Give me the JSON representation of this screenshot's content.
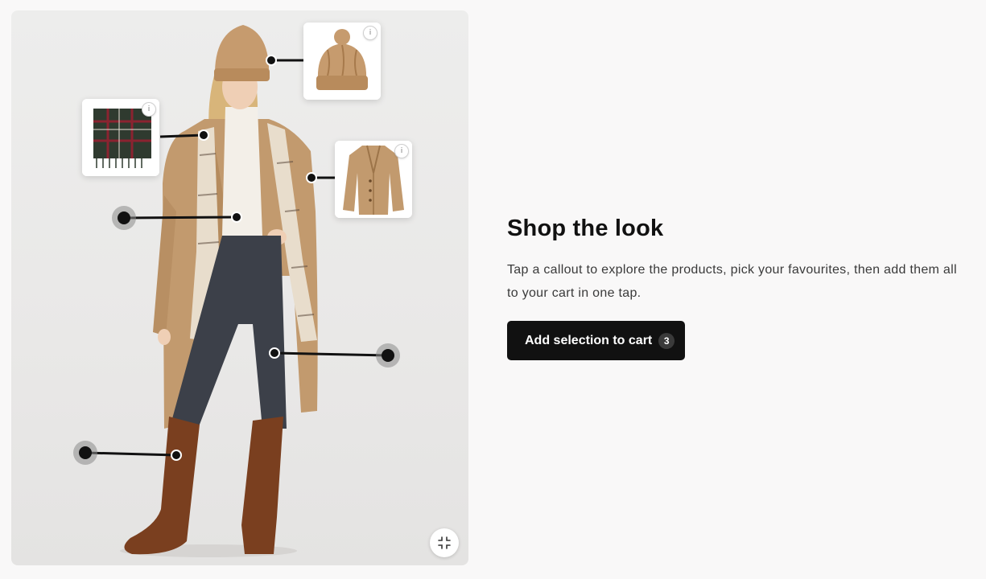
{
  "panel": {
    "title": "Shop the look",
    "description": "Tap a callout to explore the products, pick your favourites, then add them all to your cart in one tap.",
    "cta_label": "Add selection to cart",
    "cta_count": "3"
  },
  "cards": [
    {
      "icon": "beanie-icon",
      "info": "i"
    },
    {
      "icon": "scarf-icon",
      "info": "i"
    },
    {
      "icon": "coat-icon",
      "info": "i"
    }
  ],
  "colors": {
    "accent": "#111111",
    "coat": "#c29a6e",
    "beanie": "#c69b6e",
    "boots": "#7a3f1f",
    "pants": "#3c4049"
  }
}
